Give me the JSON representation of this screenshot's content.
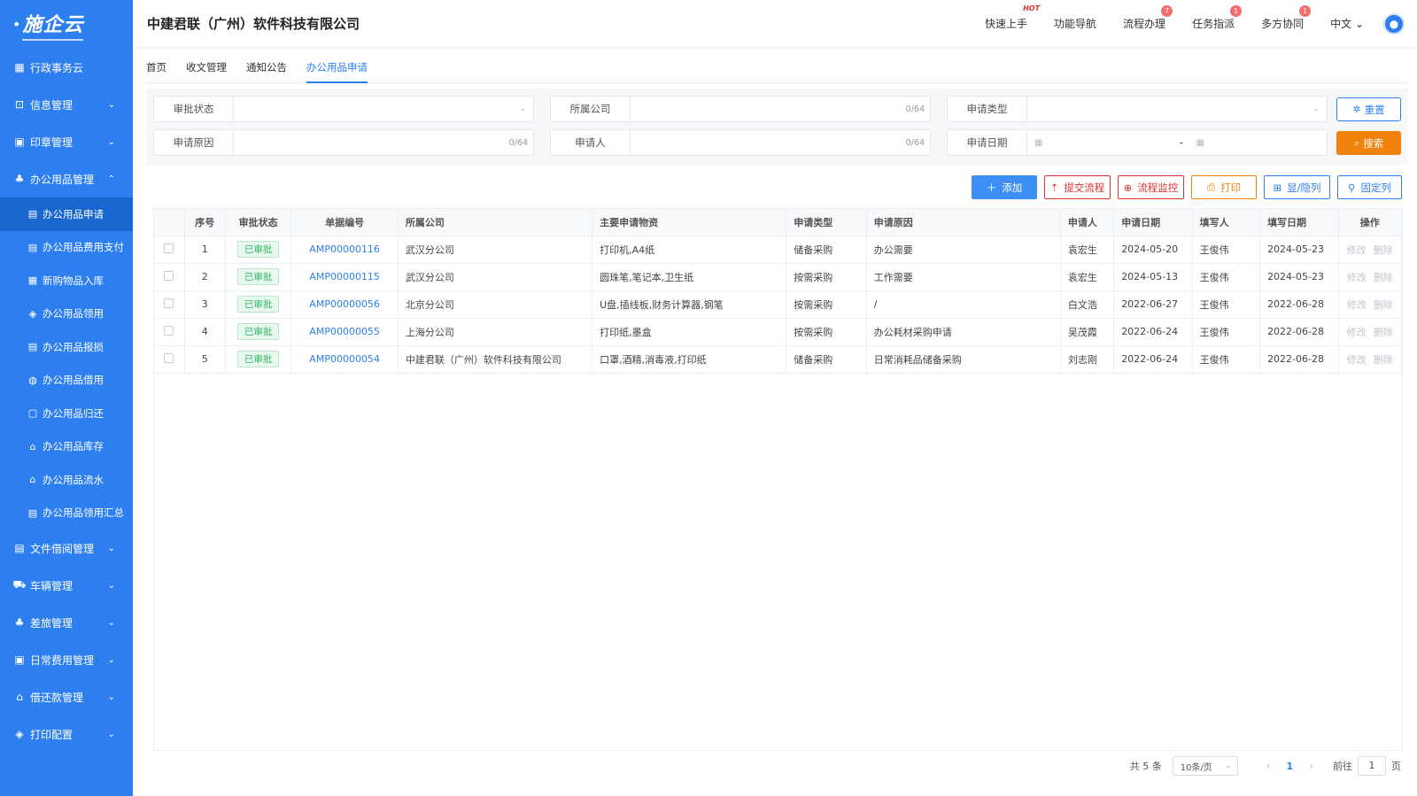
{
  "brand": {
    "logo_text": "施企云"
  },
  "sidebar": {
    "items": [
      {
        "label": "行政事务云",
        "icon": "grid-icon",
        "glyph": "▦",
        "expandable": false
      },
      {
        "label": "信息管理",
        "icon": "chart-icon",
        "glyph": "⊡",
        "expandable": true
      },
      {
        "label": "印章管理",
        "icon": "stamp-icon",
        "glyph": "▣",
        "expandable": true
      },
      {
        "label": "办公用品管理",
        "icon": "org-icon",
        "glyph": "♣",
        "expandable": true,
        "open": true
      }
    ],
    "sub_items": [
      {
        "label": "办公用品申请",
        "icon": "doc-icon",
        "glyph": "▤",
        "active": true
      },
      {
        "label": "办公用品费用支付",
        "icon": "doc-pay-icon",
        "glyph": "▤"
      },
      {
        "label": "新购物品入库",
        "icon": "calendar-in-icon",
        "glyph": "▦"
      },
      {
        "label": "办公用品领用",
        "icon": "box-icon",
        "glyph": "◈"
      },
      {
        "label": "办公用品报损",
        "icon": "doc-damage-icon",
        "glyph": "▤"
      },
      {
        "label": "办公用品借用",
        "icon": "borrow-icon",
        "glyph": "◍"
      },
      {
        "label": "办公用品归还",
        "icon": "return-icon",
        "glyph": "▢"
      },
      {
        "label": "办公用品库存",
        "icon": "warehouse-icon",
        "glyph": "⌂"
      },
      {
        "label": "办公用品流水",
        "icon": "flow-icon",
        "glyph": "⌂"
      },
      {
        "label": "办公用品领用汇总",
        "icon": "summary-icon",
        "glyph": "▤"
      }
    ],
    "items_after": [
      {
        "label": "文件借阅管理",
        "icon": "file-icon",
        "glyph": "▤"
      },
      {
        "label": "车辆管理",
        "icon": "car-icon",
        "glyph": "⛟"
      },
      {
        "label": "差旅管理",
        "icon": "travel-icon",
        "glyph": "♣"
      },
      {
        "label": "日常费用管理",
        "icon": "expense-icon",
        "glyph": "▣"
      },
      {
        "label": "借还款管理",
        "icon": "loan-icon",
        "glyph": "⌂"
      },
      {
        "label": "打印配置",
        "icon": "layers-icon",
        "glyph": "◈"
      }
    ]
  },
  "header": {
    "company": "中建君联（广州）软件科技有限公司",
    "nav": [
      {
        "label": "快速上手",
        "hot": "HOT"
      },
      {
        "label": "功能导航"
      },
      {
        "label": "流程办理",
        "badge": "7"
      },
      {
        "label": "任务指派",
        "badge": "1"
      },
      {
        "label": "多方协同",
        "badge": "1"
      }
    ],
    "lang": "中文"
  },
  "tabs": [
    "首页",
    "收文管理",
    "通知公告",
    "办公用品申请"
  ],
  "filters": {
    "status_label": "审批状态",
    "company_label": "所属公司",
    "company_count": "0/64",
    "type_label": "申请类型",
    "reason_label": "申请原因",
    "reason_count": "0/64",
    "applicant_label": "申请人",
    "applicant_count": "0/64",
    "date_label": "申请日期",
    "date_sep": "-",
    "reset_label": "重置",
    "search_label": "搜索"
  },
  "toolbar": {
    "add": "添加",
    "submit_flow": "提交流程",
    "monitor_flow": "流程监控",
    "print": "打印",
    "show_hide": "显/隐列",
    "fix_col": "固定列"
  },
  "table": {
    "columns": [
      "序号",
      "审批状态",
      "单据编号",
      "所属公司",
      "主要申请物资",
      "申请类型",
      "申请原因",
      "申请人",
      "申请日期",
      "填写人",
      "填写日期",
      "操作"
    ],
    "rows": [
      {
        "no": "1",
        "status": "已审批",
        "code": "AMP00000116",
        "company": "武汉分公司",
        "items": "打印机,A4纸",
        "type": "储备采购",
        "reason": "办公需要",
        "applicant": "袁宏生",
        "date": "2024-05-20",
        "writer": "王俊伟",
        "write_date": "2024-05-23"
      },
      {
        "no": "2",
        "status": "已审批",
        "code": "AMP00000115",
        "company": "武汉分公司",
        "items": "圆珠笔,笔记本,卫生纸",
        "type": "按需采购",
        "reason": "工作需要",
        "applicant": "袁宏生",
        "date": "2024-05-13",
        "writer": "王俊伟",
        "write_date": "2024-05-23"
      },
      {
        "no": "3",
        "status": "已审批",
        "code": "AMP00000056",
        "company": "北京分公司",
        "items": "U盘,插线板,财务计算器,钢笔",
        "type": "按需采购",
        "reason": "/",
        "applicant": "白文浩",
        "date": "2022-06-27",
        "writer": "王俊伟",
        "write_date": "2022-06-28"
      },
      {
        "no": "4",
        "status": "已审批",
        "code": "AMP00000055",
        "company": "上海分公司",
        "items": "打印纸,墨盒",
        "type": "按需采购",
        "reason": "办公耗材采购申请",
        "applicant": "吴茂霞",
        "date": "2022-06-24",
        "writer": "王俊伟",
        "write_date": "2022-06-28"
      },
      {
        "no": "5",
        "status": "已审批",
        "code": "AMP00000054",
        "company": "中建君联（广州）软件科技有限公司",
        "items": "口罩,酒精,消毒液,打印纸",
        "type": "储备采购",
        "reason": "日常消耗品储备采购",
        "applicant": "刘志刚",
        "date": "2022-06-24",
        "writer": "王俊伟",
        "write_date": "2022-06-28"
      }
    ],
    "edit_label": "修改",
    "delete_label": "删除"
  },
  "pagination": {
    "total": "共 5 条",
    "page_size": "10条/页",
    "current": "1",
    "goto_label": "前往",
    "goto_value": "1",
    "page_unit": "页"
  },
  "colors": {
    "primary": "#2d7ff0",
    "danger": "#e03131",
    "warning": "#f0820c",
    "success": "#2fb565"
  }
}
